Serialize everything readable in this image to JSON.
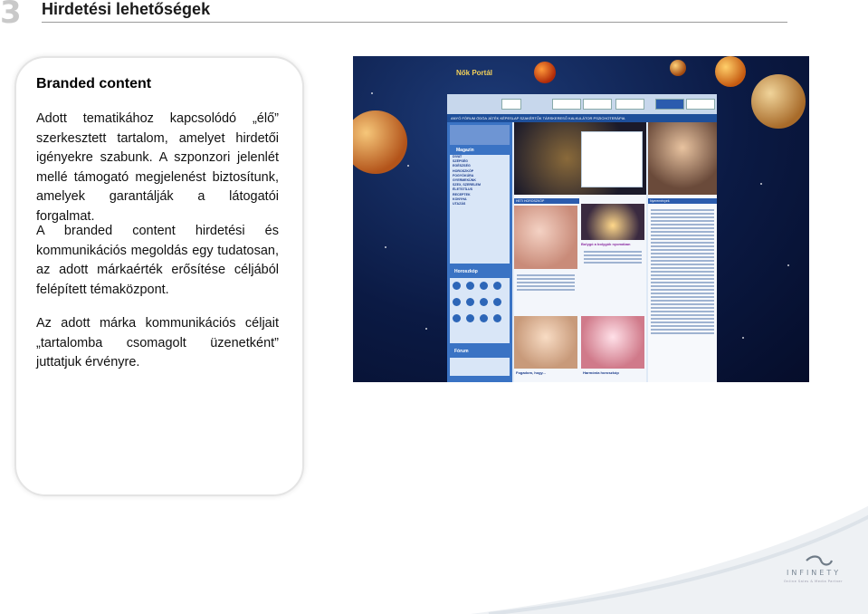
{
  "page": {
    "number": "3",
    "title": "Hirdetési lehetőségek"
  },
  "card": {
    "heading": "Branded content",
    "paragraphs": [
      "Adott tematikához kapcsolódó „élő” szerkesztett tartalom, amelyet hirdetői igényekre szabunk. A szponzori jelenlét mellé támogató megjelenést biztosítunk, amelyek garantálják a látogatói forgalmat.",
      "A branded content hirdetési és kommunikációs megoldás egy tudatosan, az adott márkaérték erősítése céljából felépített témaközpont.",
      "Az adott márka kommunikációs céljait „tartalomba csomagolt üzenetként” juttatjuk érvényre."
    ]
  },
  "screenshot": {
    "site_logo": "Nők Portál",
    "left_menu_title": "Magazin",
    "left_menu": [
      "DIVAT",
      "SZÉPSÉG",
      "EGÉSZSÉG",
      "HOROSZKÓP",
      "FOGYÓKÚRA",
      "GYERMEKÜNK",
      "SZEX, SZERELEM",
      "ÉLETSTÍLUS",
      "RECEPTEK",
      "KONYHA",
      "UTAZÁS"
    ],
    "horoscope_box": "Horoszkóp",
    "forum_box": "Fórum",
    "mid_heading": "HETI HOROSZKÓP",
    "article_title": "Bolygó a bolygók nyomában",
    "bottom_left_caption": "Fogadom, hogy...",
    "bottom_right_caption": "Harmónia horoszkóp",
    "right_heading": "Nyeremények"
  },
  "logo": {
    "text": "INFINETY",
    "sub": "Online Sales & Media Partner"
  },
  "colors": {
    "accent": "#1e4f9a",
    "page_number": "#c9c9c9",
    "swoosh": "#e6eaee"
  }
}
